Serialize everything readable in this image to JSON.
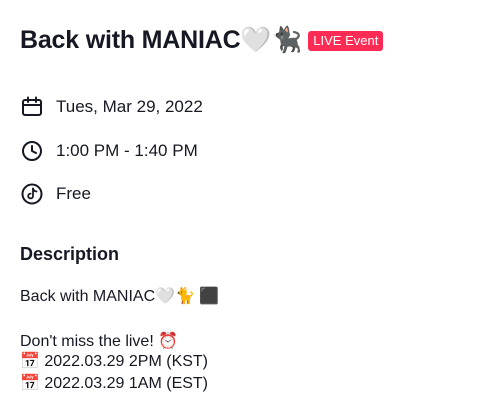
{
  "event": {
    "title": "Back with MANIAC🤍🐈‍⬛",
    "badge": "LIVE Event",
    "date": "Tues, Mar 29, 2022",
    "time": "1:00 PM - 1:40 PM",
    "price": "Free"
  },
  "description": {
    "heading": "Description",
    "lines": [
      "Back with MANIAC🤍🐈 ⬛",
      "Don't miss the live! ⏰",
      "📅 2022.03.29 2PM (KST)",
      "📅 2022.03.29 1AM (EST)"
    ]
  },
  "icons": {
    "date": "calendar-icon",
    "time": "clock-icon",
    "price": "tiktok-icon"
  },
  "colors": {
    "badge_bg": "#fe2c55",
    "text": "#161823"
  }
}
